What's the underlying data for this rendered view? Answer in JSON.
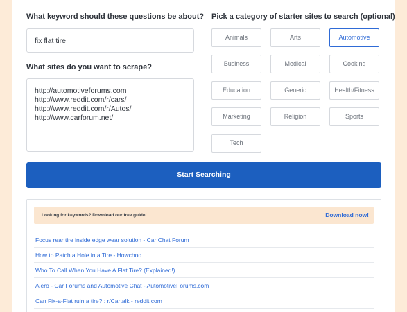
{
  "form": {
    "keyword_label": "What keyword should these questions be about?",
    "keyword_value": "fix flat tire",
    "sites_label": "What sites do you want to scrape?",
    "sites": [
      "http://automotiveforums.com",
      "http://www.reddit.com/r/cars/",
      "http://www.reddit.com/r/Autos/",
      "http://www.carforum.net/"
    ]
  },
  "categories": {
    "label": "Pick a category of starter sites to search (optional)",
    "selected": "Automotive",
    "items": [
      "Animals",
      "Arts",
      "Automotive",
      "Business",
      "Medical",
      "Cooking",
      "Education",
      "Generic",
      "Health/Fitness",
      "Marketing",
      "Religion",
      "Sports",
      "Tech"
    ]
  },
  "actions": {
    "start_label": "Start Searching"
  },
  "promo": {
    "text": "Looking for keywords? Download our free guide!",
    "link": "Download now!"
  },
  "results": [
    "Focus rear tire inside edge wear solution - Car Chat Forum",
    "How to Patch a Hole in a Tire - Howchoo",
    "Who To Call When You Have A Flat Tire? (Explained!)",
    "Alero - Car Forums and Automotive Chat - AutomotiveForums.com",
    "Can Fix-a-Flat ruin a tire? : r/Cartalk - reddit.com"
  ],
  "colors": {
    "page_bg": "#fdebd8",
    "accent": "#1c5fbf",
    "link": "#2f6bd6",
    "promo_bg": "#fbe6d0"
  }
}
